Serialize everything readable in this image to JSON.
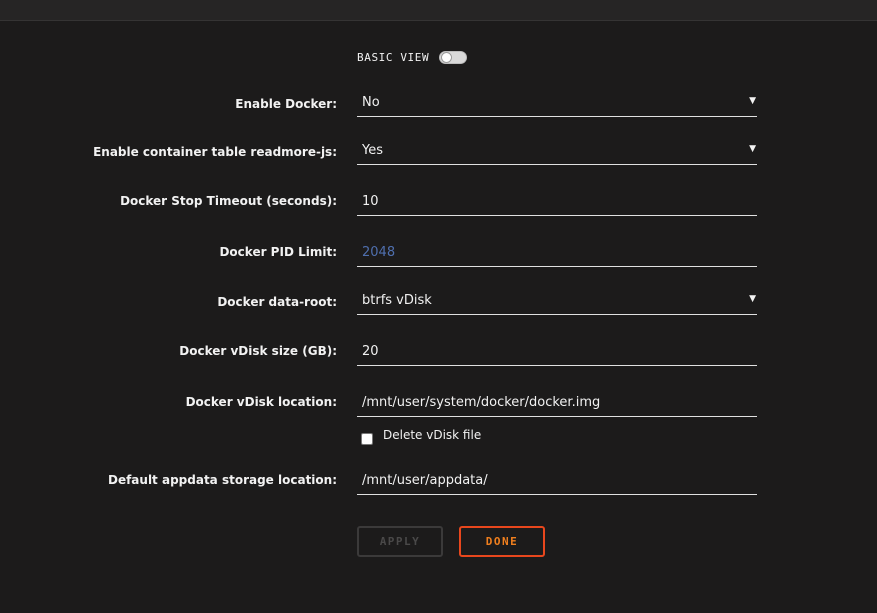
{
  "header": {
    "view_label": "BASIC VIEW"
  },
  "settings": [
    {
      "label": "Enable Docker:",
      "value": "No",
      "type": "select"
    },
    {
      "label": "Enable container table readmore-js:",
      "value": "Yes",
      "type": "select"
    },
    {
      "label": "Docker Stop Timeout (seconds):",
      "value": "10",
      "type": "input"
    },
    {
      "label": "Docker PID Limit:",
      "value": "2048",
      "type": "input-placeholder"
    },
    {
      "label": "Docker data-root:",
      "value": "btrfs vDisk",
      "type": "select"
    },
    {
      "label": "Docker vDisk size (GB):",
      "value": "20",
      "type": "input"
    },
    {
      "label": "Docker vDisk location:",
      "value": "/mnt/user/system/docker/docker.img",
      "type": "input"
    },
    {
      "label": "Default appdata storage location:",
      "value": "/mnt/user/appdata/",
      "type": "input"
    }
  ],
  "delete_vdisk": {
    "label": "Delete vDisk file",
    "checked": false
  },
  "buttons": {
    "apply": "APPLY",
    "done": "DONE"
  },
  "icons": {
    "caret": "▼"
  },
  "colors": {
    "background": "#1c1b1b",
    "accent_orange": "#f07f1e",
    "accent_red": "#e8471d",
    "placeholder_blue": "#4f6fae"
  }
}
